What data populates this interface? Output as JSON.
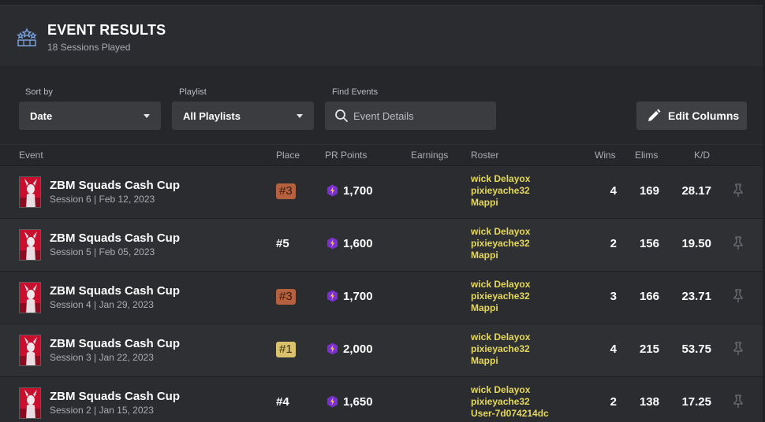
{
  "header": {
    "title": "EVENT RESULTS",
    "subtitle": "18 Sessions Played"
  },
  "filters": {
    "sort_label": "Sort by",
    "sort_value": "Date",
    "playlist_label": "Playlist",
    "playlist_value": "All Playlists",
    "find_label": "Find Events",
    "find_placeholder": "Event Details",
    "edit_columns": "Edit Columns"
  },
  "columns": {
    "event": "Event",
    "place": "Place",
    "pr_points": "PR Points",
    "earnings": "Earnings",
    "roster": "Roster",
    "wins": "Wins",
    "elims": "Elims",
    "kd": "K/D"
  },
  "colors": {
    "place_bronze": "#b5603e",
    "place_gold": "#d9c16d",
    "roster_text": "#e6d85a",
    "pr_icon": "#7a2fd0"
  },
  "rows": [
    {
      "event": "ZBM Squads Cash Cup",
      "session": "Session 6 | Feb 12, 2023",
      "place": "#3",
      "place_style": "bronze",
      "pr": "1,700",
      "roster": [
        "wick Delayox",
        "pixieyache32",
        "Mappi"
      ],
      "wins": "4",
      "elims": "169",
      "kd": "28.17"
    },
    {
      "event": "ZBM Squads Cash Cup",
      "session": "Session 5 | Feb 05, 2023",
      "place": "#5",
      "place_style": "plain",
      "pr": "1,600",
      "roster": [
        "wick Delayox",
        "pixieyache32",
        "Mappi"
      ],
      "wins": "2",
      "elims": "156",
      "kd": "19.50"
    },
    {
      "event": "ZBM Squads Cash Cup",
      "session": "Session 4 | Jan 29, 2023",
      "place": "#3",
      "place_style": "bronze",
      "pr": "1,700",
      "roster": [
        "wick Delayox",
        "pixieyache32",
        "Mappi"
      ],
      "wins": "3",
      "elims": "166",
      "kd": "23.71"
    },
    {
      "event": "ZBM Squads Cash Cup",
      "session": "Session 3 | Jan 22, 2023",
      "place": "#1",
      "place_style": "gold",
      "pr": "2,000",
      "roster": [
        "wick Delayox",
        "pixieyache32",
        "Mappi"
      ],
      "wins": "4",
      "elims": "215",
      "kd": "53.75"
    },
    {
      "event": "ZBM Squads Cash Cup",
      "session": "Session 2 | Jan 15, 2023",
      "place": "#4",
      "place_style": "plain",
      "pr": "1,650",
      "roster": [
        "wick Delayox",
        "pixieyache32",
        "User-7d074214dc"
      ],
      "wins": "2",
      "elims": "138",
      "kd": "17.25"
    }
  ]
}
